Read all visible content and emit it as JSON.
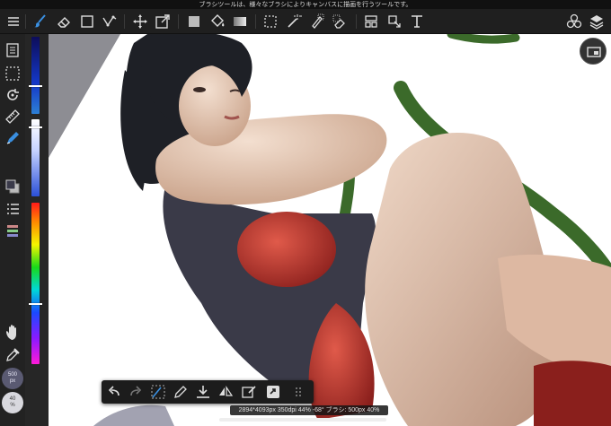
{
  "hint_bar": {
    "text": "ブラシツールは、様々なブラシによりキャンバスに描画を行うツールです。"
  },
  "top_toolbar": {
    "tools": [
      {
        "icon": "hamburger-menu-icon"
      },
      {
        "icon": "brush-tool-icon"
      },
      {
        "icon": "eraser-tool-icon"
      },
      {
        "icon": "shape-tool-icon"
      },
      {
        "icon": "bezier-tool-icon"
      },
      {
        "icon": "move-tool-icon"
      },
      {
        "icon": "transform-tool-icon"
      },
      {
        "icon": "fill-color-icon"
      },
      {
        "icon": "bucket-tool-icon"
      },
      {
        "icon": "gradient-tool-icon"
      },
      {
        "icon": "select-tool-icon"
      },
      {
        "icon": "magic-wand-icon"
      },
      {
        "icon": "select-pen-icon"
      },
      {
        "icon": "select-eraser-icon"
      },
      {
        "icon": "panel-layout-icon"
      },
      {
        "icon": "copy-select-icon"
      },
      {
        "icon": "text-tool-icon"
      },
      {
        "icon": "materials-icon"
      },
      {
        "icon": "layers-icon"
      }
    ]
  },
  "left_toolbar": {
    "tools": [
      {
        "icon": "page-icon"
      },
      {
        "icon": "selection-icon"
      },
      {
        "icon": "rotate-icon"
      },
      {
        "icon": "ruler-icon"
      },
      {
        "icon": "pen-icon"
      },
      {
        "icon": "color-swatch-icon"
      },
      {
        "icon": "layer-list-icon"
      },
      {
        "icon": "palette-icon"
      },
      {
        "icon": "hand-icon"
      },
      {
        "icon": "eyedropper-icon"
      },
      {
        "icon": "redo-icon"
      },
      {
        "icon": "undo-icon"
      }
    ],
    "brush_size": "500\npx",
    "brush_opacity": "40\n%"
  },
  "color_sliders": {
    "hue_top_color": "#0d0d5a",
    "accent": "#2d7fd4",
    "knob_dark_level": 0.45,
    "knob_light_level": 0.12,
    "knob_hue_level": 0.62
  },
  "canvas": {
    "shadow_color": "#8d8d93",
    "stroke_color": "#3b6a2a",
    "hair_color": "#1e2026",
    "skin_color": "#e7c9b0",
    "swimsuit_color": "#3a3a48",
    "red_color": "#c73a34",
    "navigator_icon": "navigator-icon"
  },
  "bottom_toolbar": {
    "tools": [
      {
        "icon": "undo-icon"
      },
      {
        "icon": "redo-icon"
      },
      {
        "icon": "transform-selection-icon"
      },
      {
        "icon": "pen-icon"
      },
      {
        "icon": "download-icon"
      },
      {
        "icon": "flip-icon"
      },
      {
        "icon": "edit-icon"
      },
      {
        "icon": "rotate-square-icon"
      },
      {
        "icon": "grip-icon"
      }
    ]
  },
  "status_bar": {
    "text": "2894*4093px 350dpi 44% -68° ブラシ: 500px 40%"
  }
}
